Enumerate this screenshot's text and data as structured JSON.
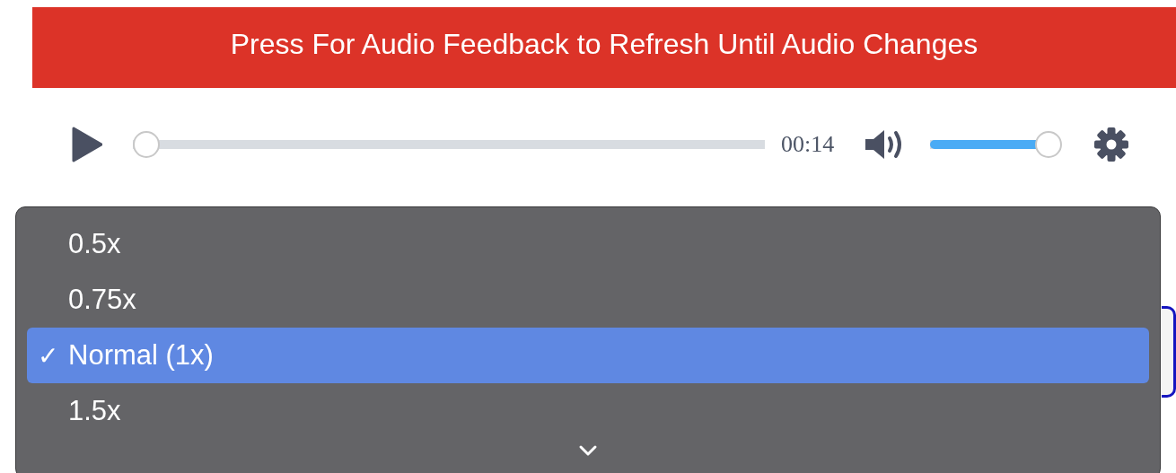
{
  "banner": {
    "label": "Press For Audio Feedback to Refresh Until Audio Changes"
  },
  "player": {
    "playing": false,
    "progress": {
      "level": 0
    },
    "time": "00:14",
    "volume": {
      "level": 0.9
    }
  },
  "speed_menu": {
    "items": [
      {
        "label": "0.5x",
        "selected": false
      },
      {
        "label": "0.75x",
        "selected": false
      },
      {
        "label": "Normal (1x)",
        "selected": true
      },
      {
        "label": "1.5x",
        "selected": false
      }
    ],
    "more_below": true,
    "check_mark": "✓"
  }
}
